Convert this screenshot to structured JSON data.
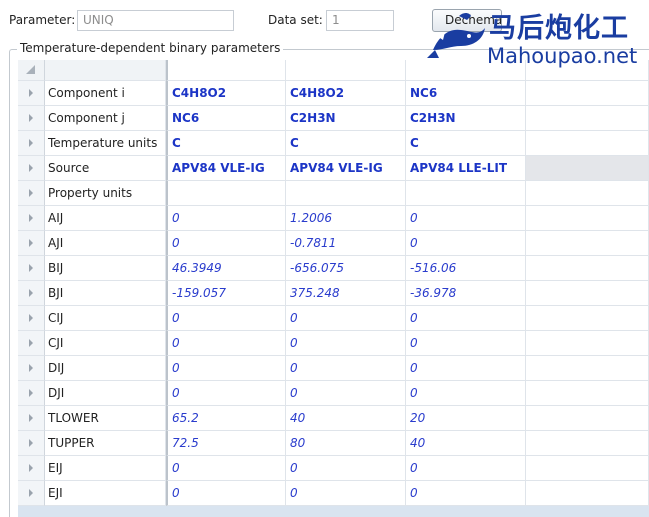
{
  "toolbar": {
    "parameter_label": "Parameter:",
    "parameter_value": "UNIQ",
    "dataset_label": "Data set:",
    "dataset_value": "1",
    "dechema_button": "Dechema"
  },
  "group_title": "Temperature-dependent binary parameters",
  "rows": [
    {
      "name": "Component  i",
      "values": [
        "C4H8O2",
        "C4H8O2",
        "NC6",
        ""
      ]
    },
    {
      "name": "Component  j",
      "values": [
        "NC6",
        "C2H3N",
        "C2H3N",
        ""
      ]
    },
    {
      "name": "Temperature units",
      "values": [
        "C",
        "C",
        "C",
        ""
      ]
    },
    {
      "name": "Source",
      "values": [
        "APV84 VLE-IG",
        "APV84 VLE-IG",
        "APV84 LLE-LIT",
        ""
      ]
    },
    {
      "name": "Property units",
      "values": [
        "",
        "",
        "",
        ""
      ]
    },
    {
      "name": "AIJ",
      "values": [
        "0",
        "1.2006",
        "0",
        ""
      ]
    },
    {
      "name": "AJI",
      "values": [
        "0",
        "-0.7811",
        "0",
        ""
      ]
    },
    {
      "name": "BIJ",
      "values": [
        "46.3949",
        "-656.075",
        "-516.06",
        ""
      ]
    },
    {
      "name": "BJI",
      "values": [
        "-159.057",
        "375.248",
        "-36.978",
        ""
      ]
    },
    {
      "name": "CIJ",
      "values": [
        "0",
        "0",
        "0",
        ""
      ]
    },
    {
      "name": "CJI",
      "values": [
        "0",
        "0",
        "0",
        ""
      ]
    },
    {
      "name": "DIJ",
      "values": [
        "0",
        "0",
        "0",
        ""
      ]
    },
    {
      "name": "DJI",
      "values": [
        "0",
        "0",
        "0",
        ""
      ]
    },
    {
      "name": "TLOWER",
      "values": [
        "65.2",
        "40",
        "20",
        ""
      ]
    },
    {
      "name": "TUPPER",
      "values": [
        "72.5",
        "80",
        "40",
        ""
      ]
    },
    {
      "name": "EIJ",
      "values": [
        "0",
        "0",
        "0",
        ""
      ]
    },
    {
      "name": "EJI",
      "values": [
        "0",
        "0",
        "0",
        ""
      ]
    }
  ],
  "watermark": {
    "chinese": "马后炮化工",
    "site": "Mahoupao.net"
  },
  "colors": {
    "value_text": "#2a3ccd",
    "watermark": "#1a3da1"
  }
}
